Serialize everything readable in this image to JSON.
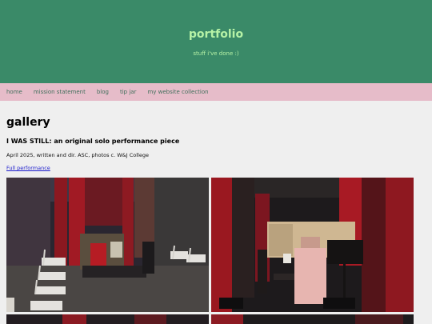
{
  "site": {
    "title": "portfolio",
    "tagline": "stuff i've done :)"
  },
  "nav": {
    "items": [
      {
        "label": "home"
      },
      {
        "label": "mission statement"
      },
      {
        "label": "blog"
      },
      {
        "label": "tip jar"
      },
      {
        "label": "my website collection"
      }
    ]
  },
  "main": {
    "page_title": "gallery",
    "section_title": "I WAS STILL: an original solo performance piece",
    "section_meta": "April 2025, written and dir. ASC, photos c. W&J College",
    "performance_link": "Full performance"
  },
  "colors": {
    "header_bg": "#3a8a68",
    "header_text": "#b6f2a6",
    "nav_bg": "#e6bcc9",
    "nav_text": "#3f6f5b",
    "page_bg": "#efefef",
    "link": "#1a1acc"
  }
}
